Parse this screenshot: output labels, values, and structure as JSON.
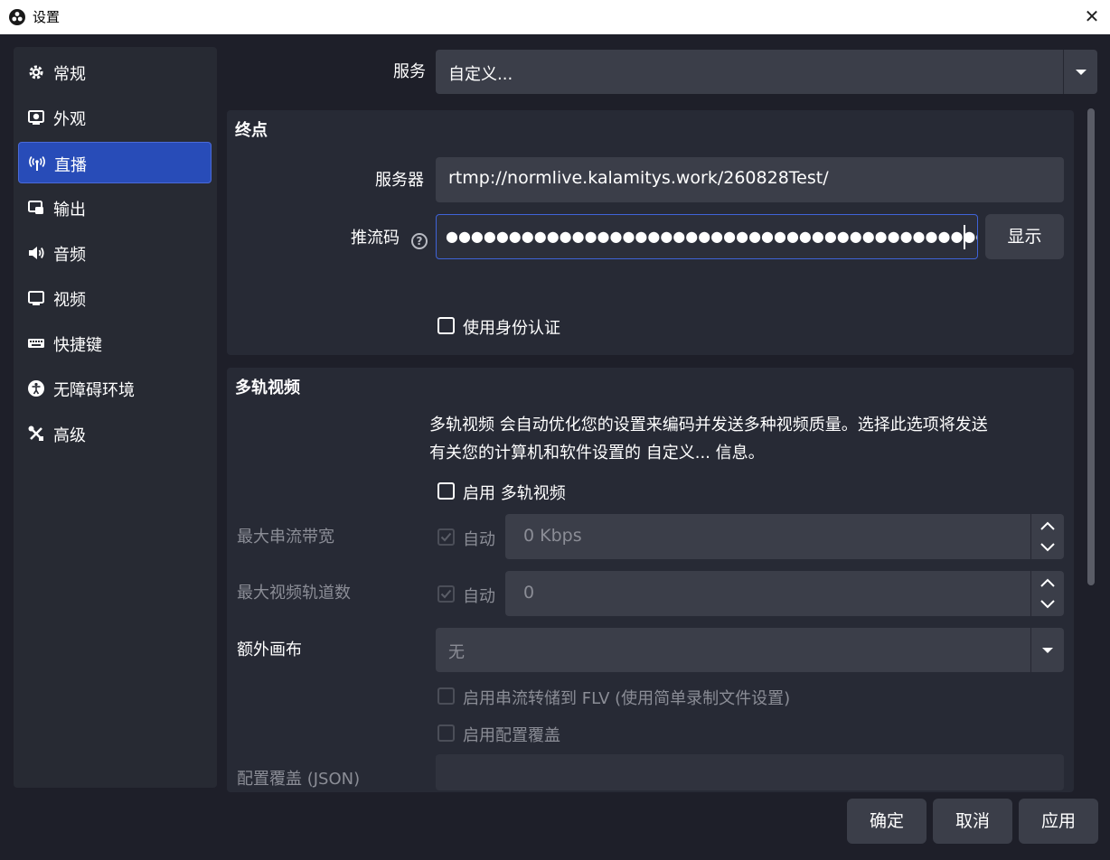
{
  "window": {
    "title": "设置",
    "close_glyph": "✕"
  },
  "sidebar": {
    "items": [
      {
        "label": "常规",
        "icon": "gear-icon"
      },
      {
        "label": "外观",
        "icon": "appearance-icon"
      },
      {
        "label": "直播",
        "icon": "antenna-icon",
        "active": true
      },
      {
        "label": "输出",
        "icon": "output-icon"
      },
      {
        "label": "音频",
        "icon": "speaker-icon"
      },
      {
        "label": "视频",
        "icon": "monitor-icon"
      },
      {
        "label": "快捷键",
        "icon": "keyboard-icon"
      },
      {
        "label": "无障碍环境",
        "icon": "accessibility-icon"
      },
      {
        "label": "高级",
        "icon": "tools-icon"
      }
    ]
  },
  "service": {
    "label": "服务",
    "value": "自定义..."
  },
  "endpoint": {
    "title": "终点",
    "server_label": "服务器",
    "server_value": "rtmp://normlive.kalamitys.work/260828Test/",
    "key_label": "推流码",
    "key_value": "●●●●●●●●●●●●●●●●●●●●●●●●●●●●●●●●●●●●●●●●●●●●●●",
    "show_button": "显示",
    "auth_label": "使用身份认证",
    "help_glyph": "?"
  },
  "multitrack": {
    "title": "多轨视频",
    "description_line1": "多轨视频 会自动优化您的设置来编码并发送多种视频质量。选择此选项将发送",
    "description_line2": "有关您的计算机和软件设置的 自定义... 信息。",
    "enable_label": "启用 多轨视频",
    "max_bitrate_label": "最大串流带宽",
    "max_bitrate_auto": "自动",
    "max_bitrate_value": "0 Kbps",
    "max_tracks_label": "最大视频轨道数",
    "max_tracks_auto": "自动",
    "max_tracks_value": "0",
    "extra_canvas_label": "额外画布",
    "extra_canvas_value": "无",
    "flv_label": "启用串流转储到 FLV (使用简单录制文件设置)",
    "override_label": "启用配置覆盖",
    "override_json_label": "配置覆盖 (JSON)"
  },
  "footer": {
    "ok": "确定",
    "cancel": "取消",
    "apply": "应用"
  },
  "colors": {
    "accent": "#284cb8",
    "background": "#1e1f29",
    "panel": "#272a35",
    "input": "#3b3e49"
  }
}
